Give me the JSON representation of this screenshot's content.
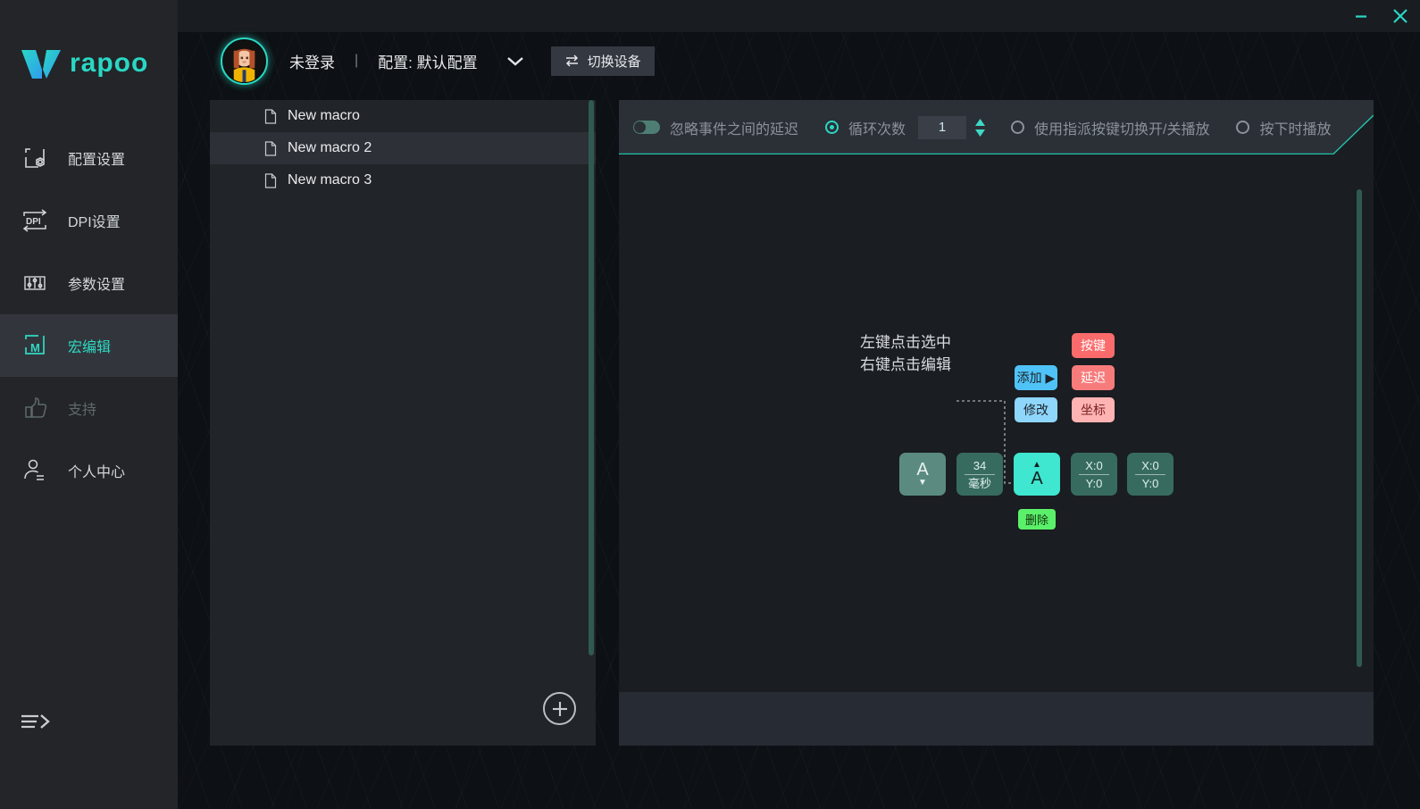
{
  "window": {
    "minimize_label": "minimize",
    "close_label": "close",
    "accent": "#2ad7c4"
  },
  "sidebar": {
    "brand": "rapoo",
    "items": [
      {
        "label": "配置设置",
        "icon": "config-icon",
        "state": "normal"
      },
      {
        "label": "DPI设置",
        "icon": "dpi-icon",
        "state": "normal"
      },
      {
        "label": "参数设置",
        "icon": "sliders-icon",
        "state": "normal"
      },
      {
        "label": "宏编辑",
        "icon": "macro-icon",
        "state": "active"
      },
      {
        "label": "支持",
        "icon": "thumbs-up-icon",
        "state": "disabled"
      },
      {
        "label": "个人中心",
        "icon": "user-icon",
        "state": "normal"
      }
    ],
    "collapse_label": "collapse-sidebar"
  },
  "header": {
    "login_status": "未登录",
    "separator": "|",
    "profile_label": "配置: 默认配置",
    "dropdown_icon": "chevron-down-icon",
    "switch_device": "切换设备",
    "switch_device_icon": "swap-icon"
  },
  "macro_list": {
    "items": [
      {
        "name": "New macro",
        "selected": false
      },
      {
        "name": "New macro 2",
        "selected": true
      },
      {
        "name": "New macro 3",
        "selected": false
      }
    ],
    "add_label": "add-macro"
  },
  "toolbar": {
    "ignore_delay_label": "忽略事件之间的延迟",
    "ignore_delay_on": false,
    "loop_count_label": "循环次数",
    "loop_count_selected": true,
    "loop_count_value": "1",
    "toggle_play_label": "使用指派按键切换开/关播放",
    "toggle_play_selected": false,
    "press_play_label": "按下时播放",
    "press_play_selected": false
  },
  "canvas": {
    "hint_line1": "左键点击选中",
    "hint_line2": "右键点击编辑",
    "context_menu": {
      "add": "添加 ▶",
      "modify": "修改",
      "key": "按键",
      "delay": "延迟",
      "coordinate": "坐标"
    },
    "events": [
      {
        "type": "key",
        "label": "A",
        "state": "down",
        "arrow": "▼"
      },
      {
        "type": "delay",
        "top": "34",
        "bottom": "毫秒"
      },
      {
        "type": "key",
        "label": "A",
        "state": "up",
        "arrow": "▲"
      },
      {
        "type": "coord",
        "top": "X:0",
        "bottom": "Y:0"
      },
      {
        "type": "coord",
        "top": "X:0",
        "bottom": "Y:0"
      }
    ],
    "delete_label": "删除"
  }
}
